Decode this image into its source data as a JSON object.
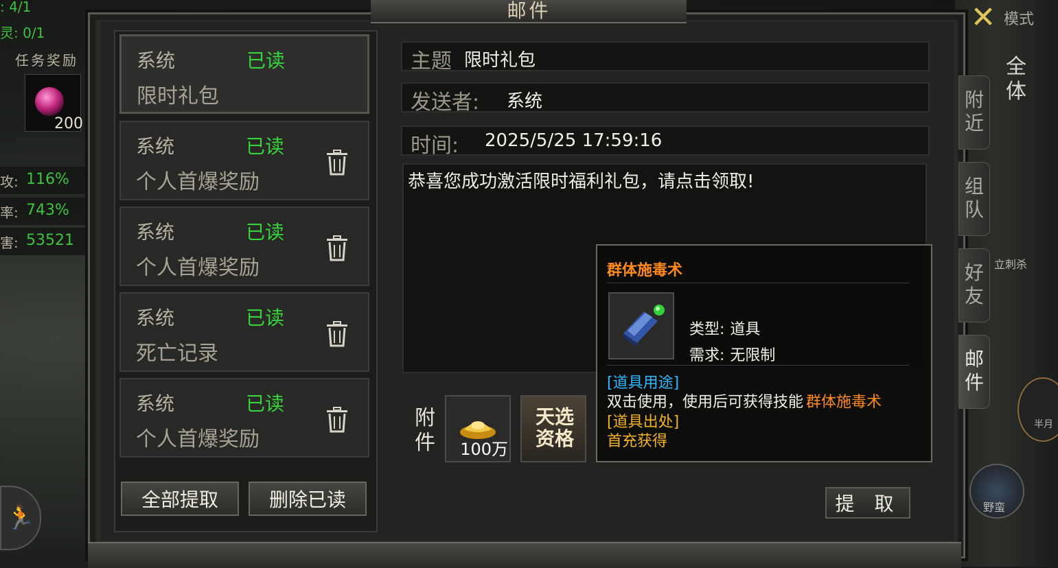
{
  "window": {
    "title": "邮件"
  },
  "hud": {
    "line1": ": 4/1",
    "line2": "灵: 0/1",
    "task_reward": "任务奖励",
    "orb_count": "200",
    "stats": [
      {
        "label": "攻:",
        "value": "116%"
      },
      {
        "label": "率:",
        "value": "743%"
      },
      {
        "label": "害:",
        "value": "53521"
      }
    ]
  },
  "mail_list": [
    {
      "sender": "系统",
      "status": "已读",
      "subject": "限时礼包",
      "selected": true
    },
    {
      "sender": "系统",
      "status": "已读",
      "subject": "个人首爆奖励"
    },
    {
      "sender": "系统",
      "status": "已读",
      "subject": "个人首爆奖励"
    },
    {
      "sender": "系统",
      "status": "已读",
      "subject": "死亡记录"
    },
    {
      "sender": "系统",
      "status": "已读",
      "subject": "个人首爆奖励"
    }
  ],
  "buttons": {
    "collect_all": "全部提取",
    "delete_read": "删除已读",
    "collect": "提 取"
  },
  "detail": {
    "subject_label": "主题",
    "subject": "限时礼包",
    "sender_label": "发送者:",
    "sender": "系统",
    "time_label": "时间:",
    "time": "2025/5/25 17:59:16",
    "body": "恭喜您成功激活限时福利礼包，请点击领取!",
    "attach_label": "附件",
    "attachments": [
      {
        "icon": "gold-ingot-icon",
        "amount": "100万"
      },
      {
        "text": "天选资格"
      }
    ]
  },
  "tooltip": {
    "title": "群体施毒术",
    "type_label": "类型:",
    "type_value": "道具",
    "req_label": "需求:",
    "req_value": "无限制",
    "usage_header": "[道具用途]",
    "usage_text": "双击使用，使用后可获得技能",
    "usage_skill": "群体施毒术",
    "source_header": "[道具出处]",
    "source_text": "首充获得"
  },
  "side_tabs": [
    "附近",
    "组队",
    "好友",
    "邮件"
  ],
  "right_tab": "全体",
  "right_labels": {
    "top": "模式",
    "mid": "立刺杀",
    "half": "半月",
    "wild": "野蛮"
  },
  "colors": {
    "read_green": "#37d23c",
    "skill_orange": "#ff8a1e",
    "cyan": "#2fb8ff",
    "gold": "#f3b323"
  }
}
